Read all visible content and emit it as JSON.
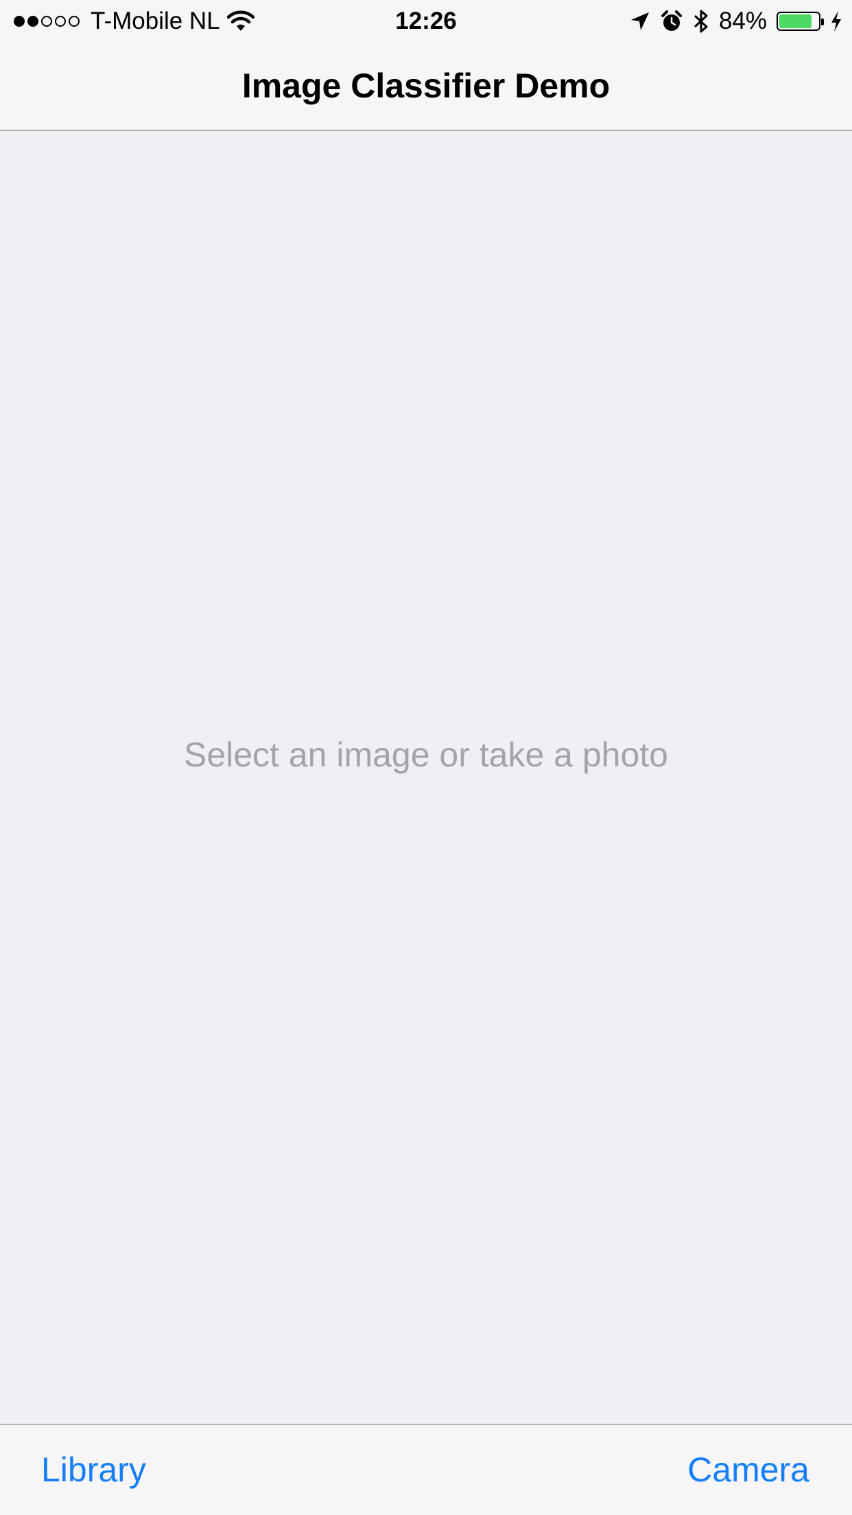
{
  "status_bar": {
    "carrier": "T-Mobile NL",
    "signal_bars_filled": 2,
    "signal_bars_total": 5,
    "time": "12:26",
    "battery_percent": "84%",
    "battery_level": 0.84,
    "icons": [
      "wifi-icon",
      "location-icon",
      "alarm-icon",
      "bluetooth-icon",
      "battery-icon",
      "charging-icon"
    ]
  },
  "nav": {
    "title": "Image Classifier Demo"
  },
  "content": {
    "placeholder": "Select an image or take a photo"
  },
  "toolbar": {
    "library_label": "Library",
    "camera_label": "Camera"
  },
  "colors": {
    "accent": "#147efb",
    "background": "#efeff4",
    "bar_background": "#f6f6f8",
    "placeholder_text": "#a4a4a8",
    "battery_fill": "#4cd964"
  }
}
